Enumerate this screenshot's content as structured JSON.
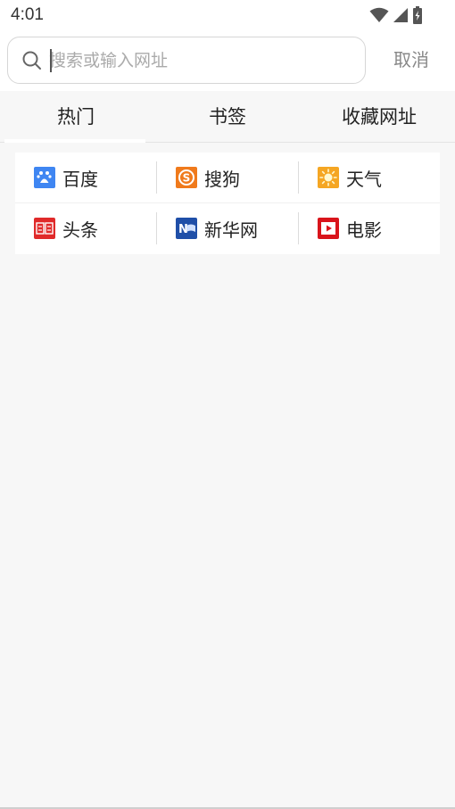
{
  "status_bar": {
    "time": "4:01",
    "icons": [
      "wifi-icon",
      "signal-icon",
      "battery-icon"
    ]
  },
  "search": {
    "placeholder": "搜索或输入网址",
    "value": "",
    "cancel_label": "取消"
  },
  "tabs": [
    {
      "label": "热门",
      "active": true
    },
    {
      "label": "书签",
      "active": false
    },
    {
      "label": "收藏网址",
      "active": false
    }
  ],
  "quick_links": [
    {
      "label": "百度",
      "icon": "baidu-icon",
      "color": "#3f86f2"
    },
    {
      "label": "搜狗",
      "icon": "sogou-icon",
      "color": "#f07a1c"
    },
    {
      "label": "天气",
      "icon": "weather-icon",
      "color": "#f5a623"
    },
    {
      "label": "头条",
      "icon": "toutiao-icon",
      "color": "#e02a2a"
    },
    {
      "label": "新华网",
      "icon": "xinhua-icon",
      "color": "#1f4fa8"
    },
    {
      "label": "电影",
      "icon": "movie-icon",
      "color": "#d9141b"
    }
  ]
}
